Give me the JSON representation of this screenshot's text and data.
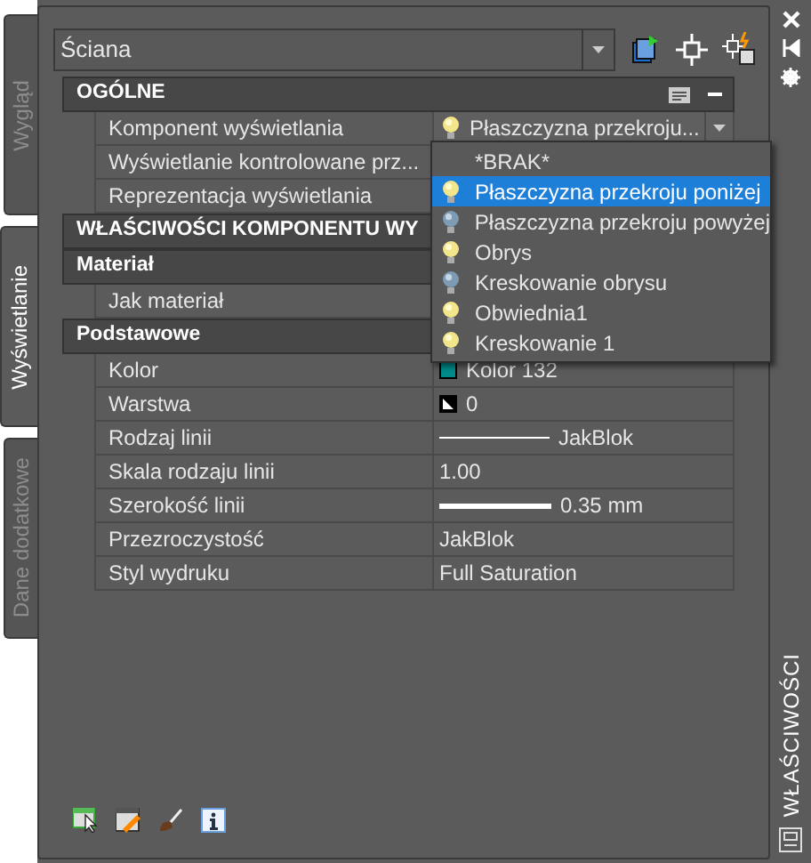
{
  "side_tabs": [
    {
      "label": "Wygląd",
      "selected": false
    },
    {
      "label": "Wyświetlanie",
      "selected": true
    },
    {
      "label": "Dane dodatkowe",
      "selected": false
    }
  ],
  "object_select": {
    "value": "Ściana"
  },
  "grid": [
    {
      "kind": "header",
      "text": "OGÓLNE",
      "expanded": true
    },
    {
      "kind": "dropdown",
      "label": "Komponent wyświetlania",
      "value": "Płaszczyzna  przekroju...",
      "lit": true
    },
    {
      "kind": "text",
      "label": "Wyświetlanie  kontrolowane  prz..."
    },
    {
      "kind": "text",
      "label": "Reprezentacja wyświetlania"
    },
    {
      "kind": "header",
      "text": "WŁAŚCIWOŚCI KOMPONENTU WY"
    },
    {
      "kind": "header",
      "text": "Materiał"
    },
    {
      "kind": "text",
      "label": "Jak materiał"
    },
    {
      "kind": "header",
      "text": "Podstawowe"
    },
    {
      "kind": "color",
      "label": "Kolor",
      "value": "Kolor 132",
      "color": "#008b8b"
    },
    {
      "kind": "layer",
      "label": "Warstwa",
      "value": "0"
    },
    {
      "kind": "linetype",
      "label": "Rodzaj linii",
      "value": "JakBlok"
    },
    {
      "kind": "text",
      "label": "Skala rodzaju linii",
      "value": "1.00"
    },
    {
      "kind": "lineweight",
      "label": "Szerokość linii",
      "value": "0.35 mm"
    },
    {
      "kind": "text",
      "label": "Przezroczystość",
      "value": "JakBlok"
    },
    {
      "kind": "text",
      "label": "Styl wydruku",
      "value": "Full Saturation"
    }
  ],
  "dropdown_list": [
    {
      "label": "*BRAK*",
      "kind": "none",
      "selected": false
    },
    {
      "label": "Płaszczyzna przekroju poniżej",
      "kind": "lit",
      "selected": true
    },
    {
      "label": "Płaszczyzna przekroju powyżej",
      "kind": "unlit",
      "selected": false
    },
    {
      "label": "Obrys",
      "kind": "lit",
      "selected": false
    },
    {
      "label": "Kreskowanie obrysu",
      "kind": "unlit",
      "selected": false
    },
    {
      "label": "Obwiednia1",
      "kind": "lit",
      "selected": false
    },
    {
      "label": "Kreskowanie 1",
      "kind": "lit",
      "selected": false
    }
  ],
  "palette_title": "WŁAŚCIWOŚCI"
}
